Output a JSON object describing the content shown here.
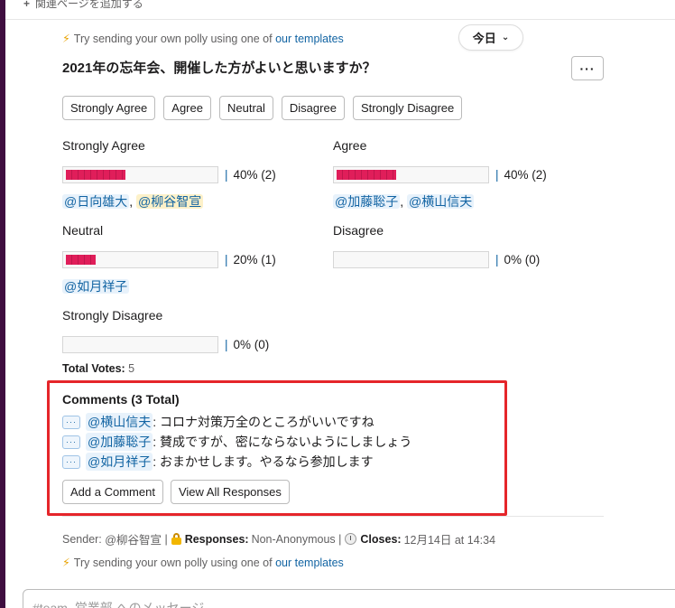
{
  "top": {
    "add_related": "関連ページを追加する"
  },
  "tip": {
    "text": "Try sending your own polly using one of",
    "link": "our templates"
  },
  "date_pill": {
    "label": "今日"
  },
  "poll": {
    "title": "2021年の忘年会、開催した方がよいと思いますか？",
    "choices": [
      "Strongly Agree",
      "Agree",
      "Neutral",
      "Disagree",
      "Strongly Disagree"
    ],
    "results": [
      {
        "label": "Strongly Agree",
        "percent": 40,
        "summary": "40% (2)",
        "voters": [
          "@日向雄大",
          "@柳谷智宣"
        ]
      },
      {
        "label": "Agree",
        "percent": 40,
        "summary": "40% (2)",
        "voters": [
          "@加藤聡子",
          "@横山信夫"
        ]
      },
      {
        "label": "Neutral",
        "percent": 20,
        "summary": "20% (1)",
        "voters": [
          "@如月祥子"
        ]
      },
      {
        "label": "Disagree",
        "percent": 0,
        "summary": "0% (0)",
        "voters": []
      },
      {
        "label": "Strongly Disagree",
        "percent": 0,
        "summary": "0% (0)",
        "voters": []
      }
    ],
    "total_votes_label": "Total Votes:",
    "total_votes": "5"
  },
  "comments": {
    "title": "Comments (3 Total)",
    "items": [
      {
        "user": "@横山信夫",
        "text": ": コロナ対策万全のところがいいですね"
      },
      {
        "user": "@加藤聡子",
        "text": ": 賛成ですが、密にならないようにしましょう"
      },
      {
        "user": "@如月祥子",
        "text": ": おまかせします。やるなら参加します"
      }
    ],
    "add_label": "Add a Comment",
    "view_label": "View All Responses"
  },
  "footer": {
    "sender_label": "Sender:",
    "sender": "@柳谷智宣",
    "responses_label": "Responses:",
    "responses": "Non-Anonymous",
    "closes_label": "Closes:",
    "closes": "12月14日 at 14:34"
  },
  "composer": {
    "placeholder": "#team_営業部 へのメッセージ"
  },
  "colors": {
    "bar": "#e01e5a",
    "mention": "#1264a3",
    "highlight": "#e5252a"
  }
}
